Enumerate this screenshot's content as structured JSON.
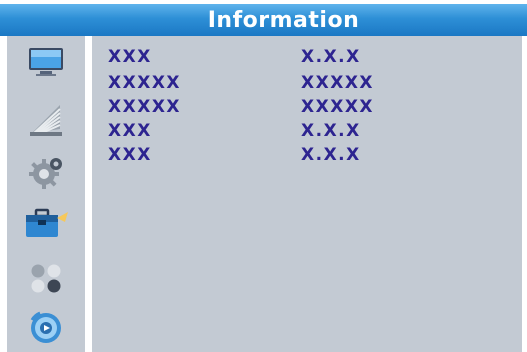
{
  "header": {
    "title": "Information"
  },
  "sidebar": {
    "items": [
      {
        "icon": "tv-screen-icon",
        "selected": false
      },
      {
        "icon": "satellite-dish-icon",
        "selected": false
      },
      {
        "icon": "gear-settings-icon",
        "selected": false
      },
      {
        "icon": "toolbox-icon",
        "selected": true
      },
      {
        "icon": "games-icon",
        "selected": false
      },
      {
        "icon": "media-player-icon",
        "selected": false
      }
    ]
  },
  "info": {
    "rows": [
      {
        "label": "XXX",
        "value": "X.X.X"
      },
      {
        "label": "XXXXX",
        "value": "XXXXX"
      },
      {
        "label": "XXXXX",
        "value": "XXXXX"
      },
      {
        "label": "XXX",
        "value": "X.X.X"
      },
      {
        "label": "XXX",
        "value": "X.X.X"
      }
    ]
  },
  "colors": {
    "title_bar": "#2d8fd6",
    "panel_background": "#c3cad3",
    "info_text": "#2d2490",
    "title_text": "#ffffff"
  }
}
